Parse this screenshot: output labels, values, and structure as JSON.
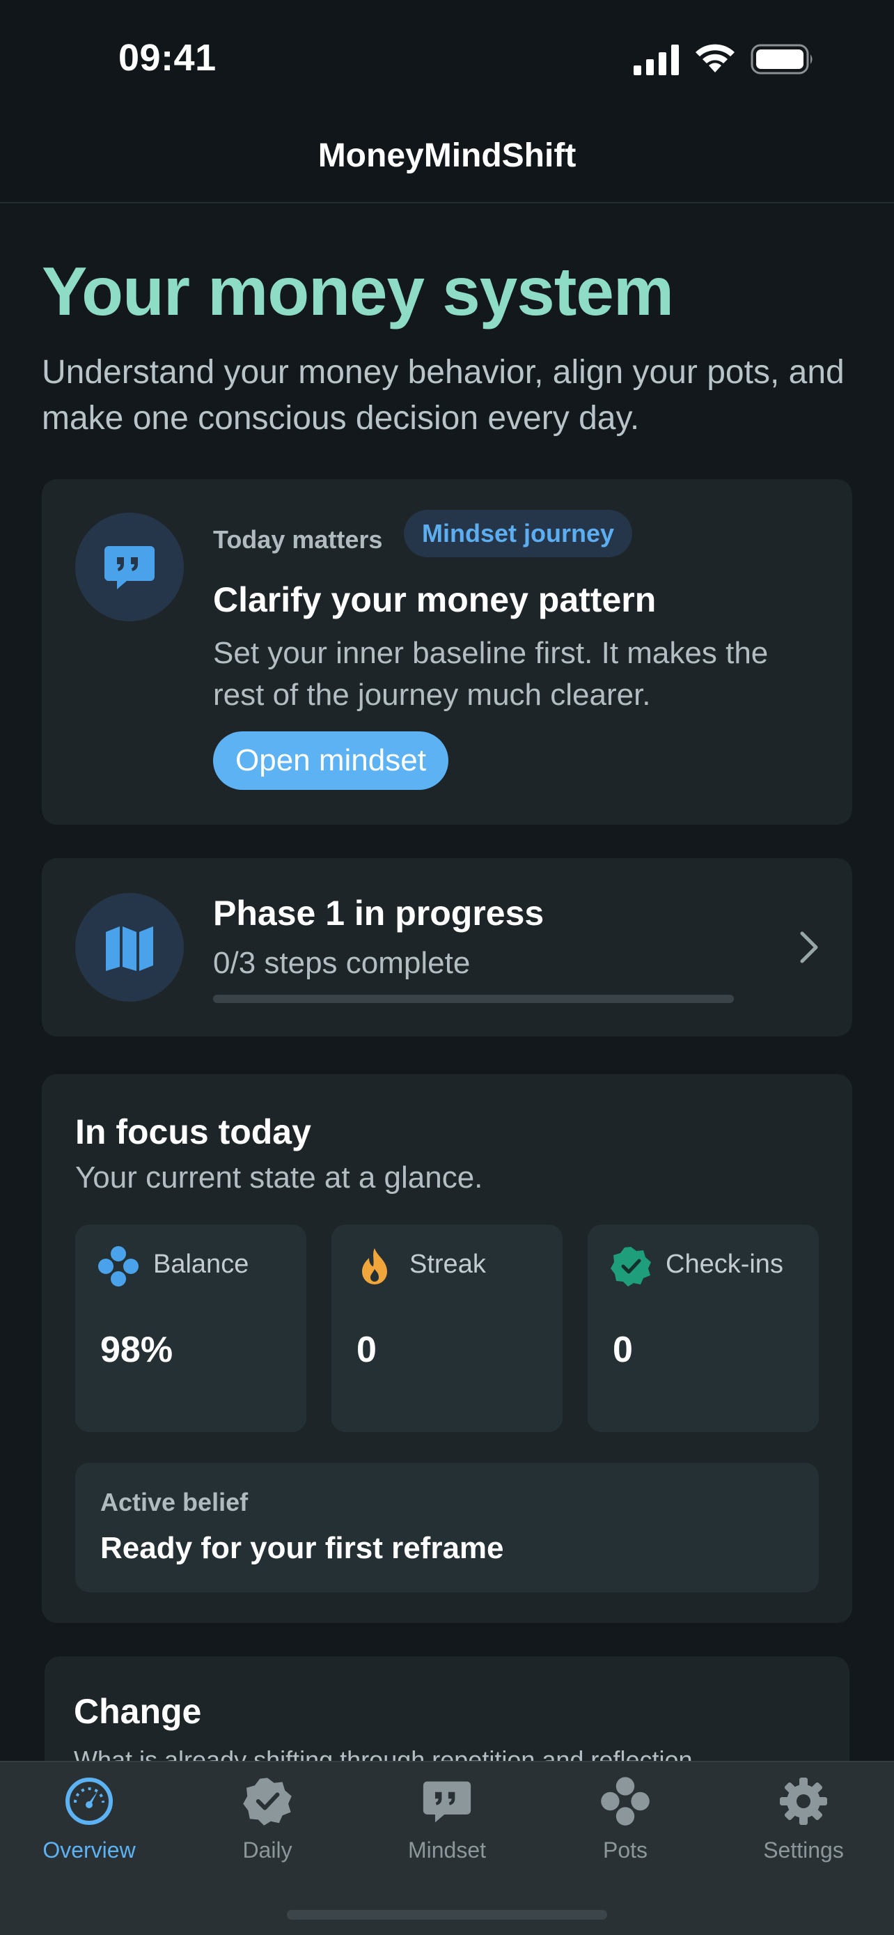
{
  "status_bar": {
    "time": "09:41"
  },
  "nav": {
    "title": "MoneyMindShift"
  },
  "hero": {
    "title": "Your money system",
    "subtitle": "Understand your money behavior, align your pots, and make one conscious decision every day."
  },
  "today_card": {
    "icon": "quote-bubble-icon",
    "kicker": "Today matters",
    "badge": "Mindset journey",
    "heading": "Clarify your money pattern",
    "body": "Set your inner baseline first. It makes the rest of the journey much clearer.",
    "button_label": "Open mindset"
  },
  "phase_card": {
    "icon": "map-icon",
    "title": "Phase 1 in progress",
    "steps_text": "0/3 steps complete",
    "steps_done": 0,
    "steps_total": 3
  },
  "focus_card": {
    "title": "In focus today",
    "subtitle": "Your current state at a glance.",
    "stats": [
      {
        "label": "Balance",
        "value": "98%",
        "icon": "pots-icon",
        "color": "#4aa3ea"
      },
      {
        "label": "Streak",
        "value": "0",
        "icon": "flame-icon",
        "color": "#f0a63a"
      },
      {
        "label": "Check-ins",
        "value": "0",
        "icon": "check-badge-icon",
        "color": "#1f9e7c"
      }
    ],
    "belief": {
      "label": "Active belief",
      "value": "Ready for your first reframe"
    }
  },
  "change_card": {
    "title": "Change",
    "subtitle": "What is already shifting through repetition and reflection."
  },
  "tab_bar": {
    "active": "Overview",
    "tabs": [
      {
        "label": "Overview",
        "icon": "gauge-icon"
      },
      {
        "label": "Daily",
        "icon": "check-badge-icon"
      },
      {
        "label": "Mindset",
        "icon": "quote-bubble-icon"
      },
      {
        "label": "Pots",
        "icon": "pots-icon"
      },
      {
        "label": "Settings",
        "icon": "gear-icon"
      }
    ]
  },
  "colors": {
    "accent": "#5cb2f3",
    "title_mint": "#8fdcc6",
    "background": "#12181c",
    "card": "#1d2528",
    "tile": "#243034"
  }
}
